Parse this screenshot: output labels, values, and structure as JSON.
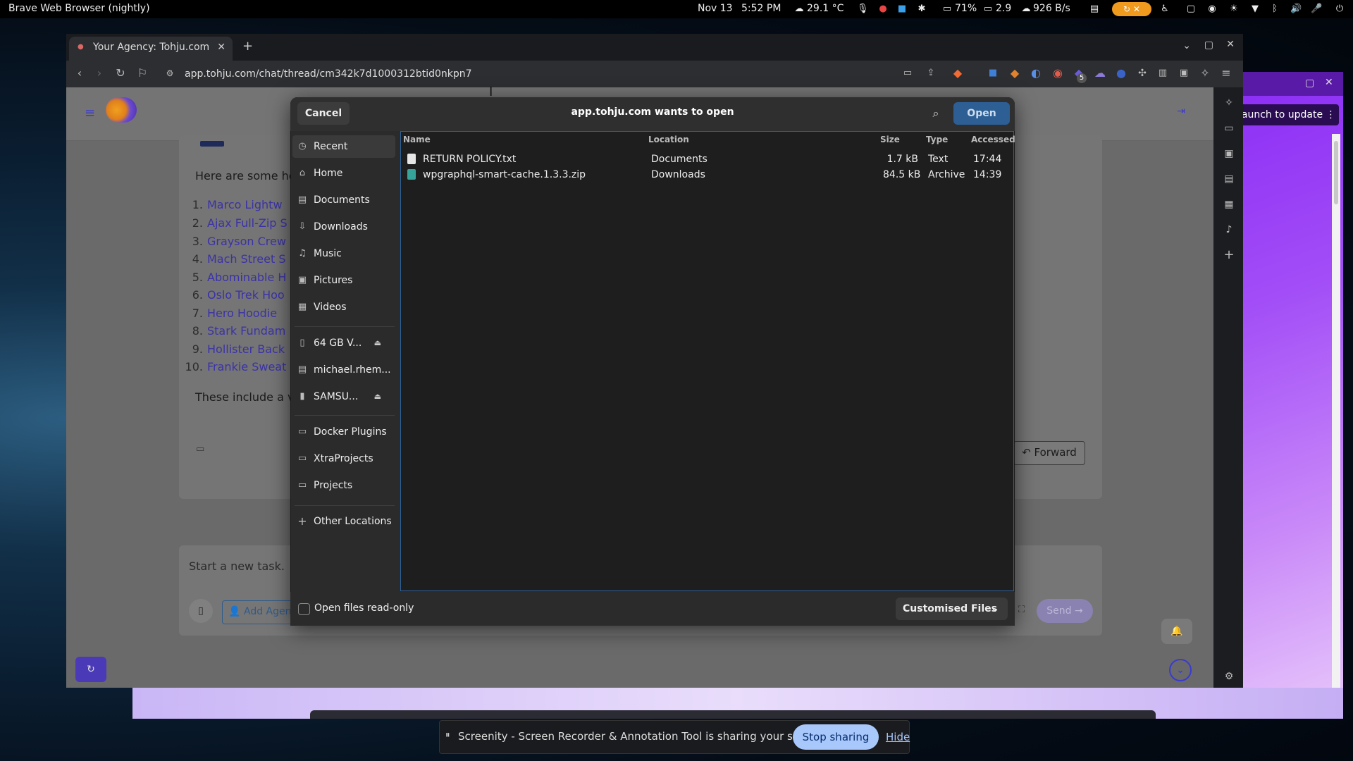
{
  "system_bar": {
    "app_title": "Brave Web Browser (nightly)",
    "date": "Nov 13",
    "time": "5:52 PM",
    "weather": "29.1 °C",
    "battery": "71%",
    "load": "2.9",
    "network": "926 B/s"
  },
  "browser": {
    "tab_title": "Your Agency: Tohju.com",
    "url": "app.tohju.com/chat/thread/cm342k7d1000312btid0nkpn7",
    "extension_badge": "5"
  },
  "background_window": {
    "update_button": "launch to update"
  },
  "chat": {
    "intro": "Here are some ho",
    "items": [
      {
        "num": "1.",
        "text": "Marco Lightw"
      },
      {
        "num": "2.",
        "text": "Ajax Full-Zip S"
      },
      {
        "num": "3.",
        "text": "Grayson Crew"
      },
      {
        "num": "4.",
        "text": "Mach Street S"
      },
      {
        "num": "5.",
        "text": "Abominable H"
      },
      {
        "num": "6.",
        "text": "Oslo Trek Hoo"
      },
      {
        "num": "7.",
        "text": "Hero Hoodie"
      },
      {
        "num": "8.",
        "text": "Stark Fundam"
      },
      {
        "num": "9.",
        "text": "Hollister Back"
      },
      {
        "num": "10.",
        "text": "Frankie Sweat"
      }
    ],
    "outro": "These include a va",
    "forward_label": "Forward",
    "composer_placeholder": "Start a new task.",
    "add_agent_label": "Add Agen",
    "send_label": "Send"
  },
  "dialog": {
    "cancel_label": "Cancel",
    "title": "app.tohju.com wants to open",
    "open_label": "Open",
    "places": [
      {
        "label": "Recent",
        "icon": "clock-icon"
      },
      {
        "label": "Home",
        "icon": "home-icon"
      },
      {
        "label": "Documents",
        "icon": "document-icon"
      },
      {
        "label": "Downloads",
        "icon": "download-icon"
      },
      {
        "label": "Music",
        "icon": "music-icon"
      },
      {
        "label": "Pictures",
        "icon": "picture-icon"
      },
      {
        "label": "Videos",
        "icon": "video-icon"
      }
    ],
    "devices": [
      {
        "label": "64 GB V...",
        "icon": "drive-icon"
      },
      {
        "label": "michael.rhem...",
        "icon": "network-drive-icon"
      },
      {
        "label": "SAMSU...",
        "icon": "phone-icon"
      }
    ],
    "bookmarks": [
      {
        "label": "Docker Plugins"
      },
      {
        "label": "XtraProjects"
      },
      {
        "label": "Projects"
      }
    ],
    "other_locations": "Other Locations",
    "columns": [
      "Name",
      "Location",
      "Size",
      "Type",
      "Accessed"
    ],
    "files": [
      {
        "name": "RETURN POLICY.txt",
        "location": "Documents",
        "size": "1.7 kB",
        "type": "Text",
        "accessed": "17:44"
      },
      {
        "name": "wpgraphql-smart-cache.1.3.3.zip",
        "location": "Downloads",
        "size": "84.5 kB",
        "type": "Archive",
        "accessed": "14:39"
      }
    ],
    "readonly_label": "Open files read-only",
    "filter_label": "Customised Files"
  },
  "sharebar": {
    "message": "Screenity - Screen Recorder & Annotation Tool is sharing your screen.",
    "stop_label": "Stop sharing",
    "hide_label": "Hide"
  }
}
